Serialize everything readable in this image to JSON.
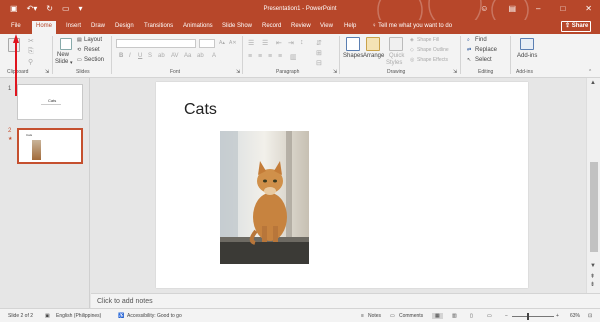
{
  "window": {
    "title": "Presentation1 - PowerPoint"
  },
  "tabs": [
    "File",
    "Home",
    "Insert",
    "Draw",
    "Design",
    "Transitions",
    "Animations",
    "Slide Show",
    "Record",
    "Review",
    "View",
    "Help"
  ],
  "tell_me": "Tell me what you want to do",
  "share_label": "Share",
  "ribbon": {
    "clipboard": {
      "label": "Clipboard"
    },
    "slides": {
      "label": "Slides",
      "new_slide": "New",
      "new_slide2": "Slide",
      "layout": "Layout",
      "reset": "Reset",
      "section": "Section"
    },
    "font": {
      "label": "Font"
    },
    "paragraph": {
      "label": "Paragraph"
    },
    "drawing": {
      "label": "Drawing",
      "shapes": "Shapes",
      "arrange": "Arrange",
      "quick_styles": "Quick",
      "quick_styles2": "Styles",
      "shape_fill": "Shape Fill",
      "shape_outline": "Shape Outline",
      "shape_effects": "Shape Effects"
    },
    "editing": {
      "label": "Editing",
      "find": "Find",
      "replace": "Replace",
      "select": "Select"
    },
    "addins": {
      "label": "Add-ins",
      "btn": "Add-ins"
    }
  },
  "thumbnails": [
    {
      "num": "1",
      "title": "Cats"
    },
    {
      "num": "2",
      "title": "Cats"
    }
  ],
  "slide": {
    "title": "Cats"
  },
  "notes_placeholder": "Click to add notes",
  "status": {
    "slide": "Slide 2 of 2",
    "language": "English (Philippines)",
    "accessibility": "Accessibility: Good to go",
    "notes": "Notes",
    "comments": "Comments",
    "zoom": "63%"
  },
  "colors": {
    "accent": "#b7472a",
    "arrow": "#e0141e"
  }
}
